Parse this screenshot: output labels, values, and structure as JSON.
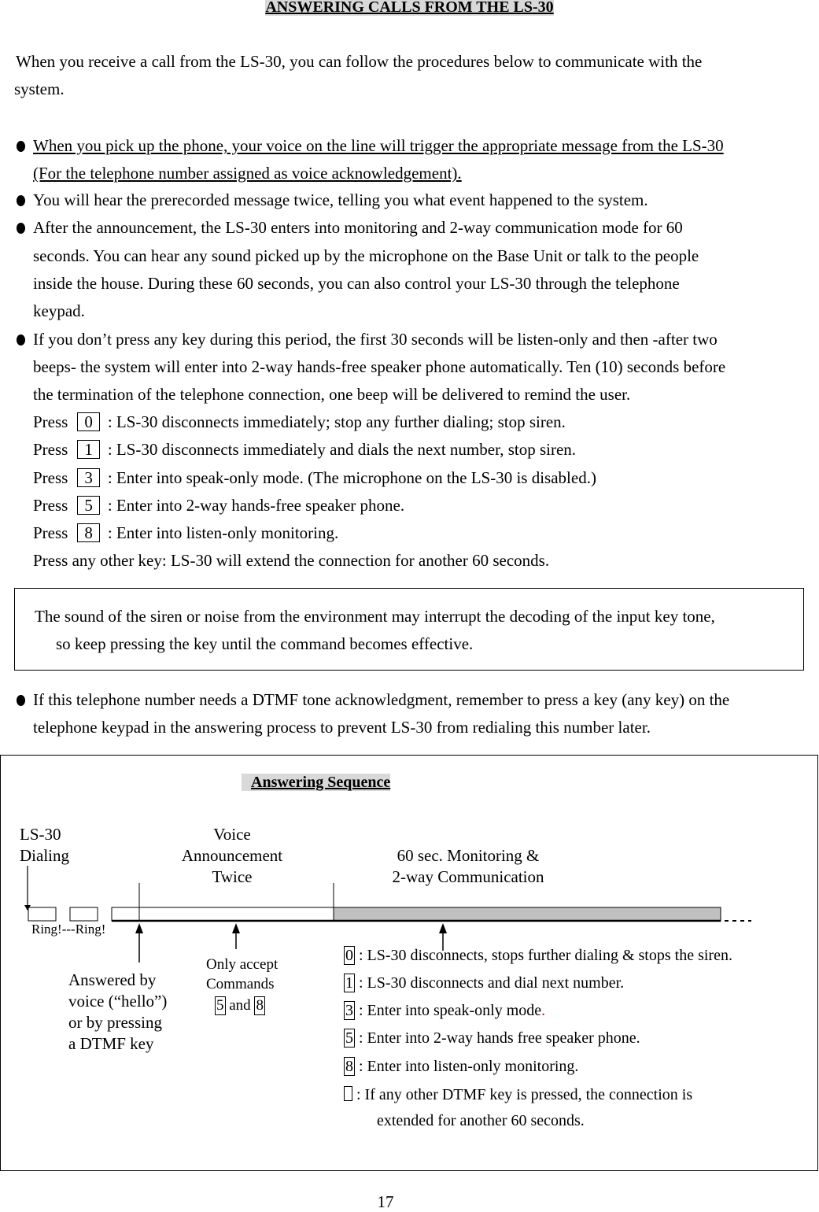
{
  "title": "ANSWERING CALLS FROM THE LS-30",
  "intro": [
    "When you receive a call from the LS-30, you can follow the procedures below to communicate with the",
    "system."
  ],
  "bullets": {
    "b1": [
      "When you pick up the phone, your voice on the line will trigger the appropriate message from the LS-30 ",
      "(For the telephone number assigned as voice acknowledgement)."
    ],
    "b2": "You will hear the prerecorded message twice, telling you what event happened to the system.",
    "b3": [
      "After the announcement, the LS-30 enters into monitoring and 2-way communication mode for 60",
      "seconds. You can hear any sound picked up by the microphone on the Base Unit or talk to the people",
      "inside the house. During these 60 seconds, you can also control your LS-30 through the telephone",
      "keypad."
    ],
    "b4": [
      "If you don’t press any key during this period, the first 30 seconds will be listen-only and then -after two",
      "beeps- the system will enter into 2-way hands-free speaker phone automatically. Ten (10) seconds before",
      "the termination of the telephone connection, one beep will be delivered to remind the user."
    ],
    "b5": [
      "If this telephone number needs a DTMF tone acknowledgment, remember to press a key (any key) on the",
      "telephone keypad in the answering process to prevent LS-30 from redialing this number later."
    ]
  },
  "press_label": "Press",
  "keys": [
    {
      "key": "0",
      "desc": ": LS-30 disconnects immediately; stop any further dialing; stop siren."
    },
    {
      "key": "1",
      "desc": ": LS-30 disconnects immediately and dials the next number, stop siren."
    },
    {
      "key": "3",
      "desc": ": Enter into speak-only mode. (The microphone on the LS-30 is disabled.)"
    },
    {
      "key": "5",
      "desc": ": Enter into 2-way hands-free speaker phone."
    },
    {
      "key": "8",
      "desc": ": Enter into listen-only monitoring."
    }
  ],
  "other_key": "Press any other key: LS-30 will extend the connection for another 60 seconds.",
  "note": [
    "The sound of the siren or noise from the environment may interrupt the decoding of the input key tone,",
    "so keep pressing the key until the command becomes effective."
  ],
  "sequence": {
    "title": "Answering Sequence",
    "dialing": [
      "LS-30",
      "Dialing"
    ],
    "voice": [
      "Voice",
      "Announcement",
      "Twice"
    ],
    "monitor": [
      "60 sec. Monitoring &",
      "2-way Communication"
    ],
    "ring": "Ring!---Ring!",
    "answered": [
      "Answered by",
      "voice (“hello”)",
      "or by pressing",
      "a DTMF key"
    ],
    "only_accept": [
      "Only accept",
      "Commands"
    ],
    "only_keys": [
      "5",
      "and",
      "8"
    ],
    "commands": [
      {
        "key": "0",
        "desc": ": LS-30 disconnects, stops further dialing & stops the siren."
      },
      {
        "key": "1",
        "desc": ": LS-30 disconnects and dial next number."
      },
      {
        "key": "3",
        "desc": ": Enter into speak-only mode",
        "tail": "."
      },
      {
        "key": "5",
        "desc": ": Enter into 2-way hands free speaker phone."
      },
      {
        "key": "8",
        "desc": ": Enter into listen-only monitoring."
      }
    ],
    "other": [
      ": If any other DTMF key is pressed, the connection is",
      "extended for another 60 seconds."
    ],
    "accent_color": "#e00000",
    "monitor_fill": "#c0c0c0"
  },
  "page_number": "17"
}
